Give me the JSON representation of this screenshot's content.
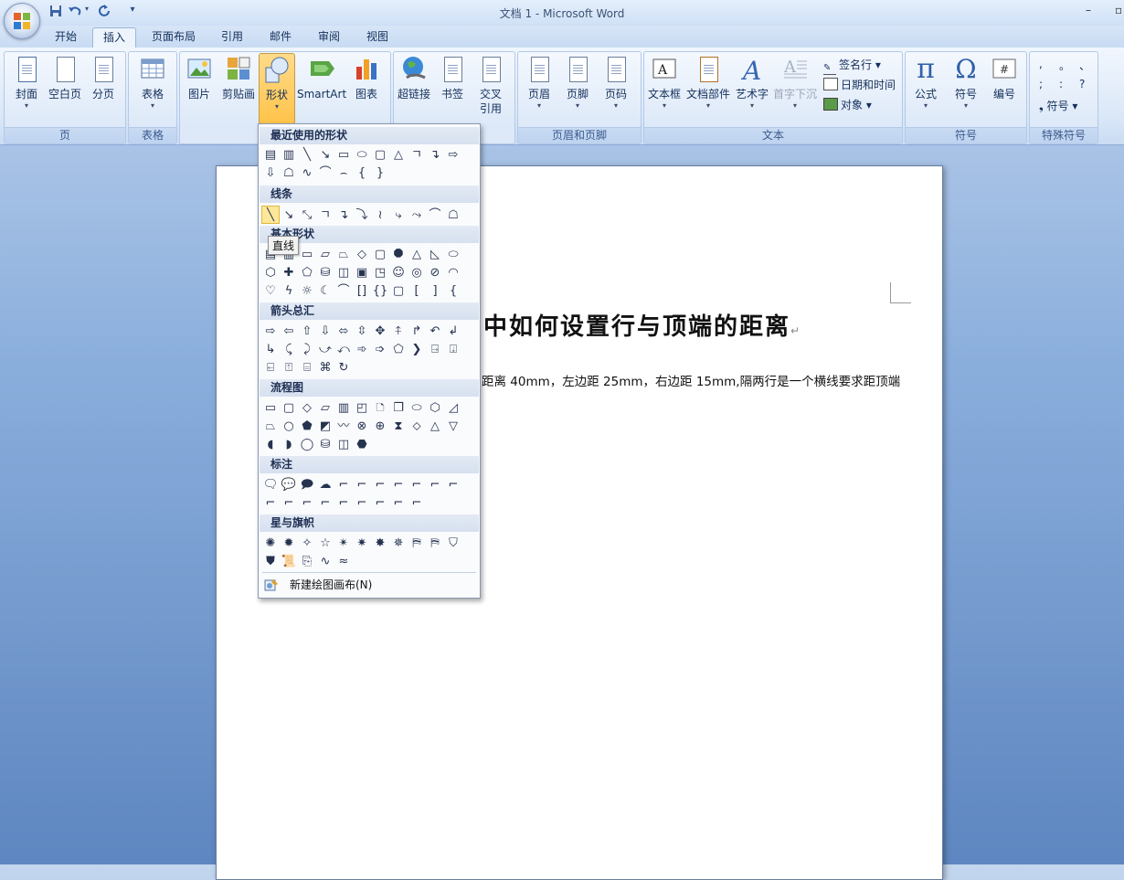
{
  "window": {
    "title": "文档 1 - Microsoft Word",
    "minimize": "–",
    "restore": "▫"
  },
  "qat": {
    "save_icon": "save-icon",
    "undo_icon": "undo-icon",
    "redo_icon": "redo-icon",
    "more": "▾"
  },
  "tabs": [
    "开始",
    "插入",
    "页面布局",
    "引用",
    "邮件",
    "审阅",
    "视图"
  ],
  "active_tab": "插入",
  "ribbon": {
    "groups": {
      "pages": {
        "label": "页",
        "buttons": [
          "封面",
          "空白页",
          "分页"
        ]
      },
      "tables": {
        "label": "表格",
        "buttons": [
          "表格"
        ]
      },
      "illustrations": {
        "buttons": [
          "图片",
          "剪贴画",
          "形状",
          "SmartArt",
          "图表"
        ]
      },
      "links": {
        "buttons": [
          "超链接",
          "书签",
          "交叉",
          "引用"
        ]
      },
      "header_footer": {
        "label": "页眉和页脚",
        "buttons": [
          "页眉",
          "页脚",
          "页码"
        ]
      },
      "text": {
        "label": "文本",
        "buttons": [
          "文本框",
          "文档部件",
          "艺术字",
          "首字下沉"
        ],
        "small": [
          "签名行 ▾",
          "日期和时间",
          "对象 ▾"
        ]
      },
      "symbols": {
        "label": "符号",
        "buttons": [
          "公式",
          "符号",
          "编号"
        ]
      },
      "special": {
        "label": "特殊符号",
        "chars": [
          ",",
          "。",
          "、",
          ";",
          ":",
          "?"
        ],
        "more": "符号 ▾"
      }
    }
  },
  "shapes_menu": {
    "sections": [
      {
        "title": "最近使用的形状"
      },
      {
        "title": "线条"
      },
      {
        "title": "基本形状"
      },
      {
        "title": "箭头总汇"
      },
      {
        "title": "流程图"
      },
      {
        "title": "标注"
      },
      {
        "title": "星与旗帜"
      }
    ],
    "new_canvas": "新建绘图画布(N)",
    "tooltip": "直线"
  },
  "document": {
    "heading": "中如何设置行与顶端的距离",
    "body": "距离 40mm，左边距 25mm，右边距 15mm,隔两行是一个横线要求距顶端",
    "pilcrow": "↵"
  }
}
